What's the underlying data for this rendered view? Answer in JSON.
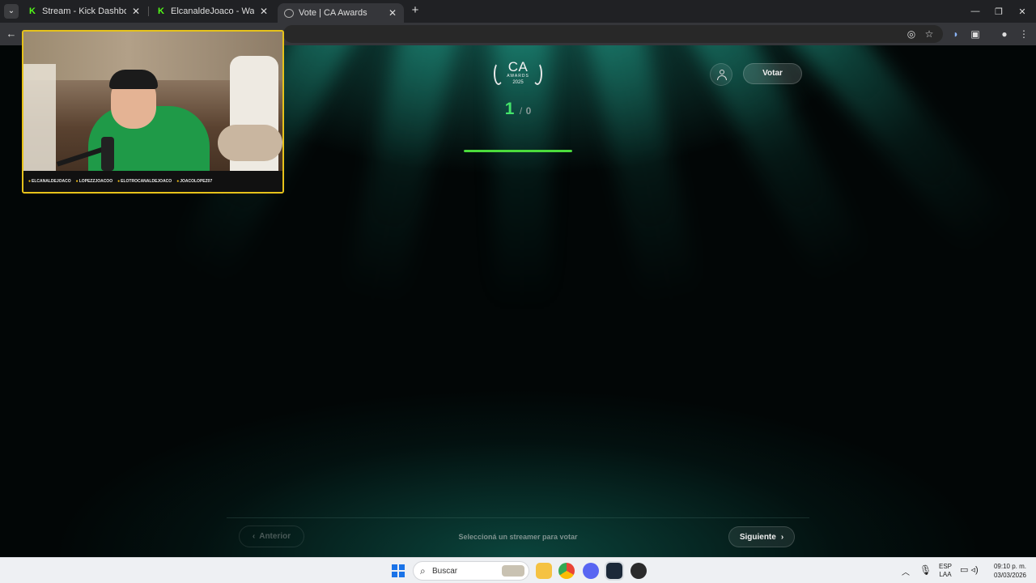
{
  "browser": {
    "tabs": [
      {
        "title": "Stream - Kick Dashboard",
        "favicon": "kick-icon",
        "active": false
      },
      {
        "title": "ElcanaldeJoaco - Watch the VOD",
        "favicon": "kick-icon",
        "active": false
      },
      {
        "title": "Vote | CA Awards",
        "favicon": "ca-awards-icon",
        "active": true
      }
    ],
    "tab_menu_icon": "chevron-down-icon",
    "new_tab_icon": "plus-icon",
    "toolbar_icons": [
      "eye-off-icon",
      "star-icon",
      "extension-icon",
      "puzzle-icon",
      "profile-icon",
      "more-icon"
    ]
  },
  "webcam": {
    "socials": [
      "ELCANALDEJOACO",
      "LOPEZZJOACOO",
      "ELOTROCANALDEJOACO",
      "JOACOLOPEZ07"
    ]
  },
  "page": {
    "logo": {
      "title": "CA",
      "subtitle": "AWARDS",
      "year": "2025"
    },
    "counter": {
      "current": "1",
      "separator": "/",
      "total": "0"
    },
    "progress_fraction": 1.0,
    "votar_label": "Votar",
    "user_icon": "user-icon",
    "prev_label": "Anterior",
    "hint": "Seleccioná un streamer para votar",
    "next_label": "Siguiente",
    "accent_color": "#43e46a"
  },
  "taskbar": {
    "search_label": "Buscar",
    "apps": [
      "file-explorer-icon",
      "chrome-icon",
      "discord-icon",
      "steam-icon",
      "obs-icon"
    ],
    "lang_line1": "ESP",
    "lang_line2": "LAA",
    "time": "09:10 p. m.",
    "date": "03/03/2026"
  }
}
